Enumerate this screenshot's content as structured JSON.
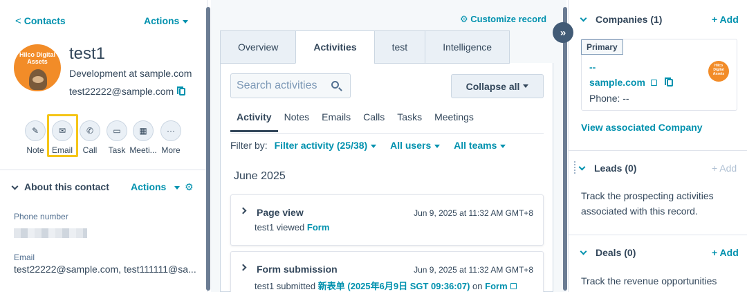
{
  "left": {
    "back_label": "Contacts",
    "actions_label": "Actions",
    "avatar_text": "Hilco Digital Assets",
    "name": "test1",
    "role": "Development at sample.com",
    "email": "test22222@sample.com",
    "quick_actions": [
      {
        "label": "Note",
        "icon": "edit-icon",
        "glyph": "✎"
      },
      {
        "label": "Email",
        "icon": "envelope-icon",
        "glyph": "✉"
      },
      {
        "label": "Call",
        "icon": "phone-icon",
        "glyph": "✆"
      },
      {
        "label": "Task",
        "icon": "task-icon",
        "glyph": "▭"
      },
      {
        "label": "Meeti...",
        "icon": "calendar-icon",
        "glyph": "▦"
      },
      {
        "label": "More",
        "icon": "more-icon",
        "glyph": "···"
      }
    ],
    "about": {
      "title": "About this contact",
      "actions_label": "Actions",
      "gear_glyph": "⚙",
      "phone_label": "Phone number",
      "email_label": "Email",
      "email_value": "test22222@sample.com, test111111@sa..."
    }
  },
  "middle": {
    "customize_label": "Customize record",
    "customize_glyph": "⚙",
    "tabs": [
      "Overview",
      "Activities",
      "test",
      "Intelligence"
    ],
    "active_tab": "Activities",
    "search_placeholder": "Search activities",
    "collapse_label": "Collapse all",
    "sub_tabs": [
      "Activity",
      "Notes",
      "Emails",
      "Calls",
      "Tasks",
      "Meetings"
    ],
    "filter": {
      "label": "Filter by:",
      "activity": "Filter activity (25/38)",
      "users": "All users",
      "teams": "All teams"
    },
    "month": "June 2025",
    "activities": [
      {
        "title": "Page view",
        "time": "Jun 9, 2025 at 11:32 AM GMT+8",
        "desc_prefix": "test1 viewed",
        "desc_link": "Form",
        "desc_mid": "",
        "desc_link2": ""
      },
      {
        "title": "Form submission",
        "time": "Jun 9, 2025 at 11:32 AM GMT+8",
        "desc_prefix": "test1 submitted",
        "desc_link": "新表单 (2025年6月9日 SGT 09:36:07)",
        "desc_mid": "on",
        "desc_link2": "Form"
      }
    ]
  },
  "right": {
    "expand_glyph": "»",
    "companies": {
      "title": "Companies (1)",
      "add_label": "+ Add",
      "primary_tag": "Primary",
      "name": "--",
      "domain": "sample.com",
      "phone": "Phone: --",
      "avatar_text": "Hilco Digital Assets",
      "view_link": "View associated Company"
    },
    "leads": {
      "title": "Leads (0)",
      "add_label": "+ Add",
      "text": "Track the prospecting activities associated with this record."
    },
    "deals": {
      "title": "Deals (0)",
      "add_label": "+ Add",
      "text": "Track the revenue opportunities"
    }
  }
}
